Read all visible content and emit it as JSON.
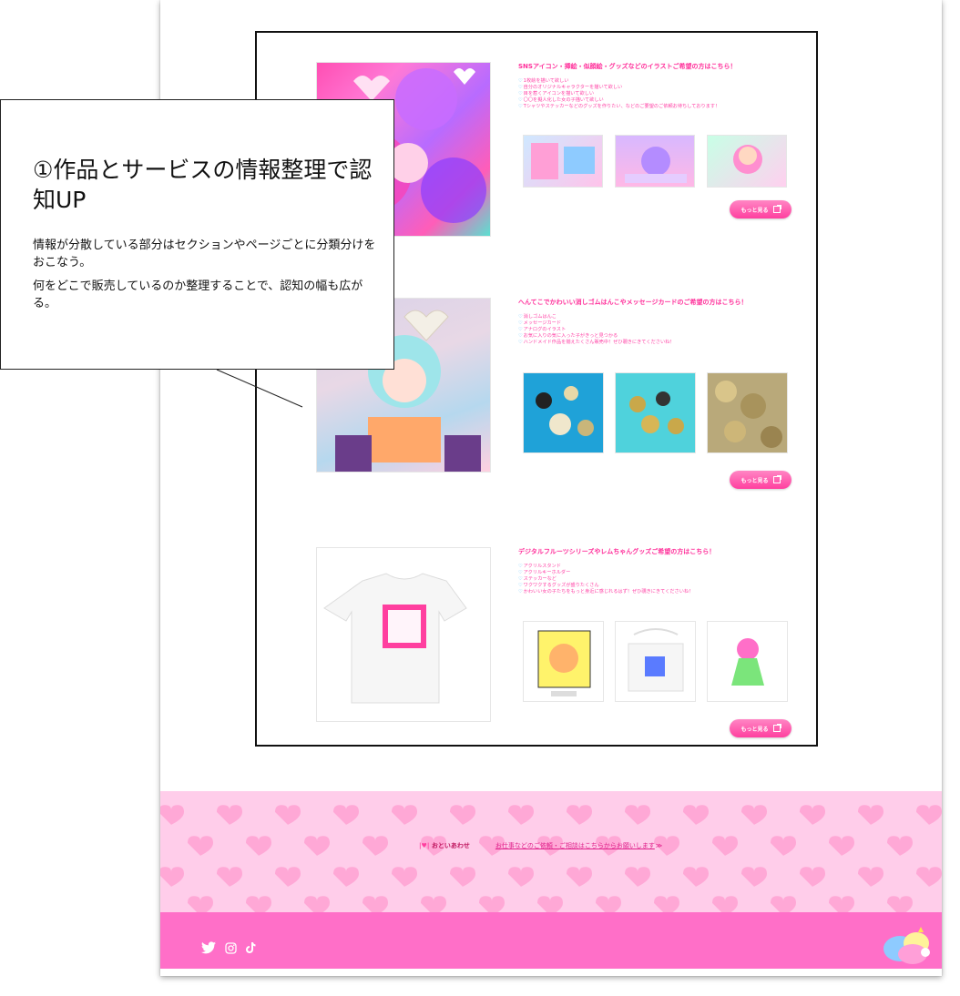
{
  "sections": [
    {
      "title": "SNSアイコン・挿絵・似顔絵・グッズなどのイラストご希望の方はこちら！",
      "bullets": [
        "1枚絵を描いて欲しい",
        "自分のオリジナルキャラクターを描いて欲しい",
        "目を惹くアイコンを描いて欲しい",
        "〇〇を擬人化した女の子描いて欲しい",
        "Tシャツやステッカーなどのグッズを作りたい、などのご要望のご依頼お待ちしております！"
      ],
      "button_label": "もっと見る"
    },
    {
      "title": "へんてこでかわいい消しゴムはんこやメッセージカードのご希望の方はこちら！",
      "bullets": [
        "消しゴムはんこ",
        "メッセージカード",
        "アナログのイラスト",
        "お気に入りの気に入った子がきっと見つかる",
        "ハンドメイド作品を揃えたくさん販売中！ぜひ覗きにきてくださいね！"
      ],
      "button_label": "もっと見る"
    },
    {
      "title": "デジタルフルーツシリーズやレムちゃんグッズご希望の方はこちら！",
      "bullets": [
        "アクリルスタンド",
        "アクリルキーホルダー",
        "ステッカーなど",
        "ワクワクするグッズが盛りたくさん",
        "かわいい女の子たちをもっと身近に感じれるはず！ぜひ覗きにきてくださいね！"
      ],
      "button_label": "もっと見る"
    }
  ],
  "footer": {
    "contact_label": "おといあわせ",
    "contact_link": "お仕事などのご依頼・ご相談はこちらからお願いします"
  },
  "callout": {
    "title": "①作品とサービスの情報整理で認知UP",
    "body": [
      "情報が分散している部分はセクションやページごとに分類分けをおこなう。",
      "何をどこで販売しているのか整理することで、認知の幅も広がる。"
    ]
  },
  "icons": [
    "twitter-icon",
    "instagram-icon",
    "tiktok-icon",
    "external-link-icon",
    "heart-icon"
  ],
  "colors": {
    "accent": "#ff3f9f",
    "footer": "#ff6fc8",
    "hearts_bg": "#ffcdea",
    "heart": "#ff9bcf"
  }
}
